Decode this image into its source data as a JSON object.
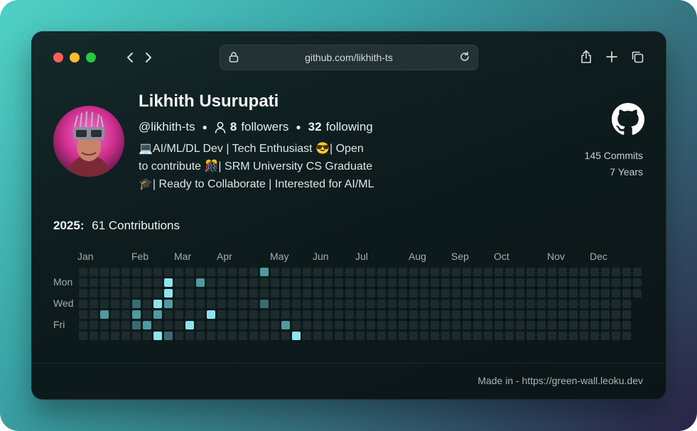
{
  "browser": {
    "url": "github.com/likhith-ts"
  },
  "profile": {
    "name": "Likhith Usurupati",
    "handle": "@likhith-ts",
    "followers_count": "8",
    "followers_label": "followers",
    "following_count": "32",
    "following_label": "following",
    "bio_lines": [
      "💻AI/ML/DL Dev | Tech Enthusiast 😎| Open",
      "to contribute 🎊| SRM University CS Graduate",
      "🎓| Ready to Collaborate | Interested for AI/ML"
    ],
    "commits": "145 Commits",
    "years": "7 Years"
  },
  "contributions": {
    "year": "2025:",
    "total": "61 Contributions",
    "months": [
      "Jan",
      "Feb",
      "Mar",
      "Apr",
      "May",
      "Jun",
      "Jul",
      "Aug",
      "Sep",
      "Oct",
      "Nov",
      "Dec"
    ],
    "day_labels": [
      "Mon",
      "Wed",
      "Fri"
    ],
    "weeks": 53,
    "colors": {
      "empty": "#1d2b2d",
      "level1": "#3a6b70",
      "level2": "#4f9aa1",
      "level3": "#8fe3ee"
    },
    "active_cells": [
      {
        "week": 2,
        "day": 4,
        "level": 2
      },
      {
        "week": 5,
        "day": 3,
        "level": 1
      },
      {
        "week": 5,
        "day": 4,
        "level": 2
      },
      {
        "week": 5,
        "day": 5,
        "level": 1
      },
      {
        "week": 6,
        "day": 5,
        "level": 2
      },
      {
        "week": 7,
        "day": 3,
        "level": 3
      },
      {
        "week": 7,
        "day": 4,
        "level": 2
      },
      {
        "week": 7,
        "day": 6,
        "level": 3
      },
      {
        "week": 8,
        "day": 1,
        "level": 3
      },
      {
        "week": 8,
        "day": 2,
        "level": 3
      },
      {
        "week": 8,
        "day": 3,
        "level": 2
      },
      {
        "week": 8,
        "day": 6,
        "level": 1
      },
      {
        "week": 10,
        "day": 5,
        "level": 3
      },
      {
        "week": 11,
        "day": 1,
        "level": 2
      },
      {
        "week": 12,
        "day": 4,
        "level": 3
      },
      {
        "week": 17,
        "day": 0,
        "level": 2
      },
      {
        "week": 17,
        "day": 3,
        "level": 1
      },
      {
        "week": 19,
        "day": 5,
        "level": 2
      },
      {
        "week": 20,
        "day": 6,
        "level": 3
      }
    ]
  },
  "footer": {
    "text": "Made in - https://green-wall.leoku.dev"
  }
}
